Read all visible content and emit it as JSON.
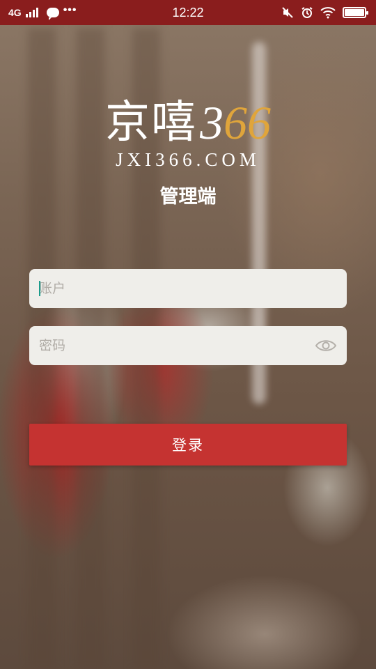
{
  "status_bar": {
    "network": "4G",
    "time": "12:22",
    "more_dots": "•••",
    "battery_level": 1.0
  },
  "logo": {
    "chinese": "京嘻",
    "number_first": "3",
    "number_rest": "66",
    "domain": "JXI366.COM",
    "accent_color": "#e0a53b"
  },
  "subtitle": "管理端",
  "form": {
    "account_placeholder": "账户",
    "account_value": "",
    "password_placeholder": "密码",
    "password_value": ""
  },
  "login_label": "登录",
  "colors": {
    "status_bar": "#8a1d1d",
    "button": "#c53331",
    "field_bg": "#efeeea"
  }
}
